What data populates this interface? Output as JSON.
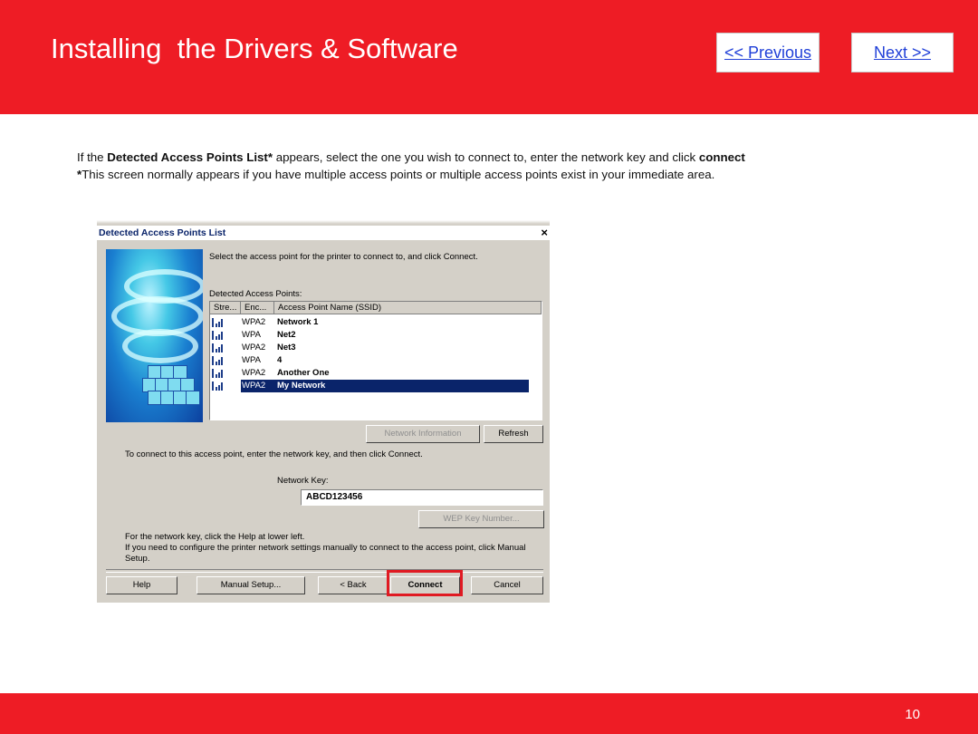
{
  "header": {
    "title": "Installing  the Drivers & Software",
    "prev_label": "<< Previous",
    "next_label": "Next >>"
  },
  "intro": {
    "line1_pre": "If the ",
    "line1_bold": "Detected Access Points List*",
    "line1_post": " appears,  select the one you wish to connect to, enter the network key and click ",
    "line1_bold2": "connect",
    "line2_bold": "*",
    "line2_text": "This screen normally appears if you have multiple access points or multiple access points exist in your immediate area."
  },
  "dialog": {
    "title": "Detected Access Points List",
    "close_glyph": "×",
    "instruction": "Select the access point for the printer to connect to, and click Connect.",
    "list_label": "Detected Access Points:",
    "columns": [
      "Stre...",
      "Enc...",
      "Access Point Name (SSID)"
    ],
    "rows": [
      {
        "enc": "WPA2",
        "ssid": "Network 1"
      },
      {
        "enc": "WPA",
        "ssid": "Net2"
      },
      {
        "enc": "WPA2",
        "ssid": "Net3"
      },
      {
        "enc": "WPA",
        "ssid": "4"
      },
      {
        "enc": "WPA2",
        "ssid": "Another One"
      },
      {
        "enc": "WPA2",
        "ssid": "My Network"
      }
    ],
    "selected_row": 5,
    "network_info_label": "Network Information",
    "refresh_label": "Refresh",
    "connect_instruction": "To connect to this access point, enter the network key, and then click Connect.",
    "network_key_label": "Network Key:",
    "network_key_value": "ABCD123456",
    "wep_key_label": "WEP Key Number...",
    "help_text_1": "For the network key, click the Help at lower left.",
    "help_text_2": "If you need to configure the printer network settings manually to connect to the access point, click Manual",
    "help_text_3": "Setup.",
    "buttons": {
      "help": "Help",
      "manual": "Manual Setup...",
      "back": "< Back",
      "connect": "Connect",
      "cancel": "Cancel"
    }
  },
  "footer": {
    "page_number": "10"
  },
  "colors": {
    "brand_red": "#ee1c25",
    "link_blue": "#1f3fd8",
    "selection_navy": "#0a246a"
  }
}
